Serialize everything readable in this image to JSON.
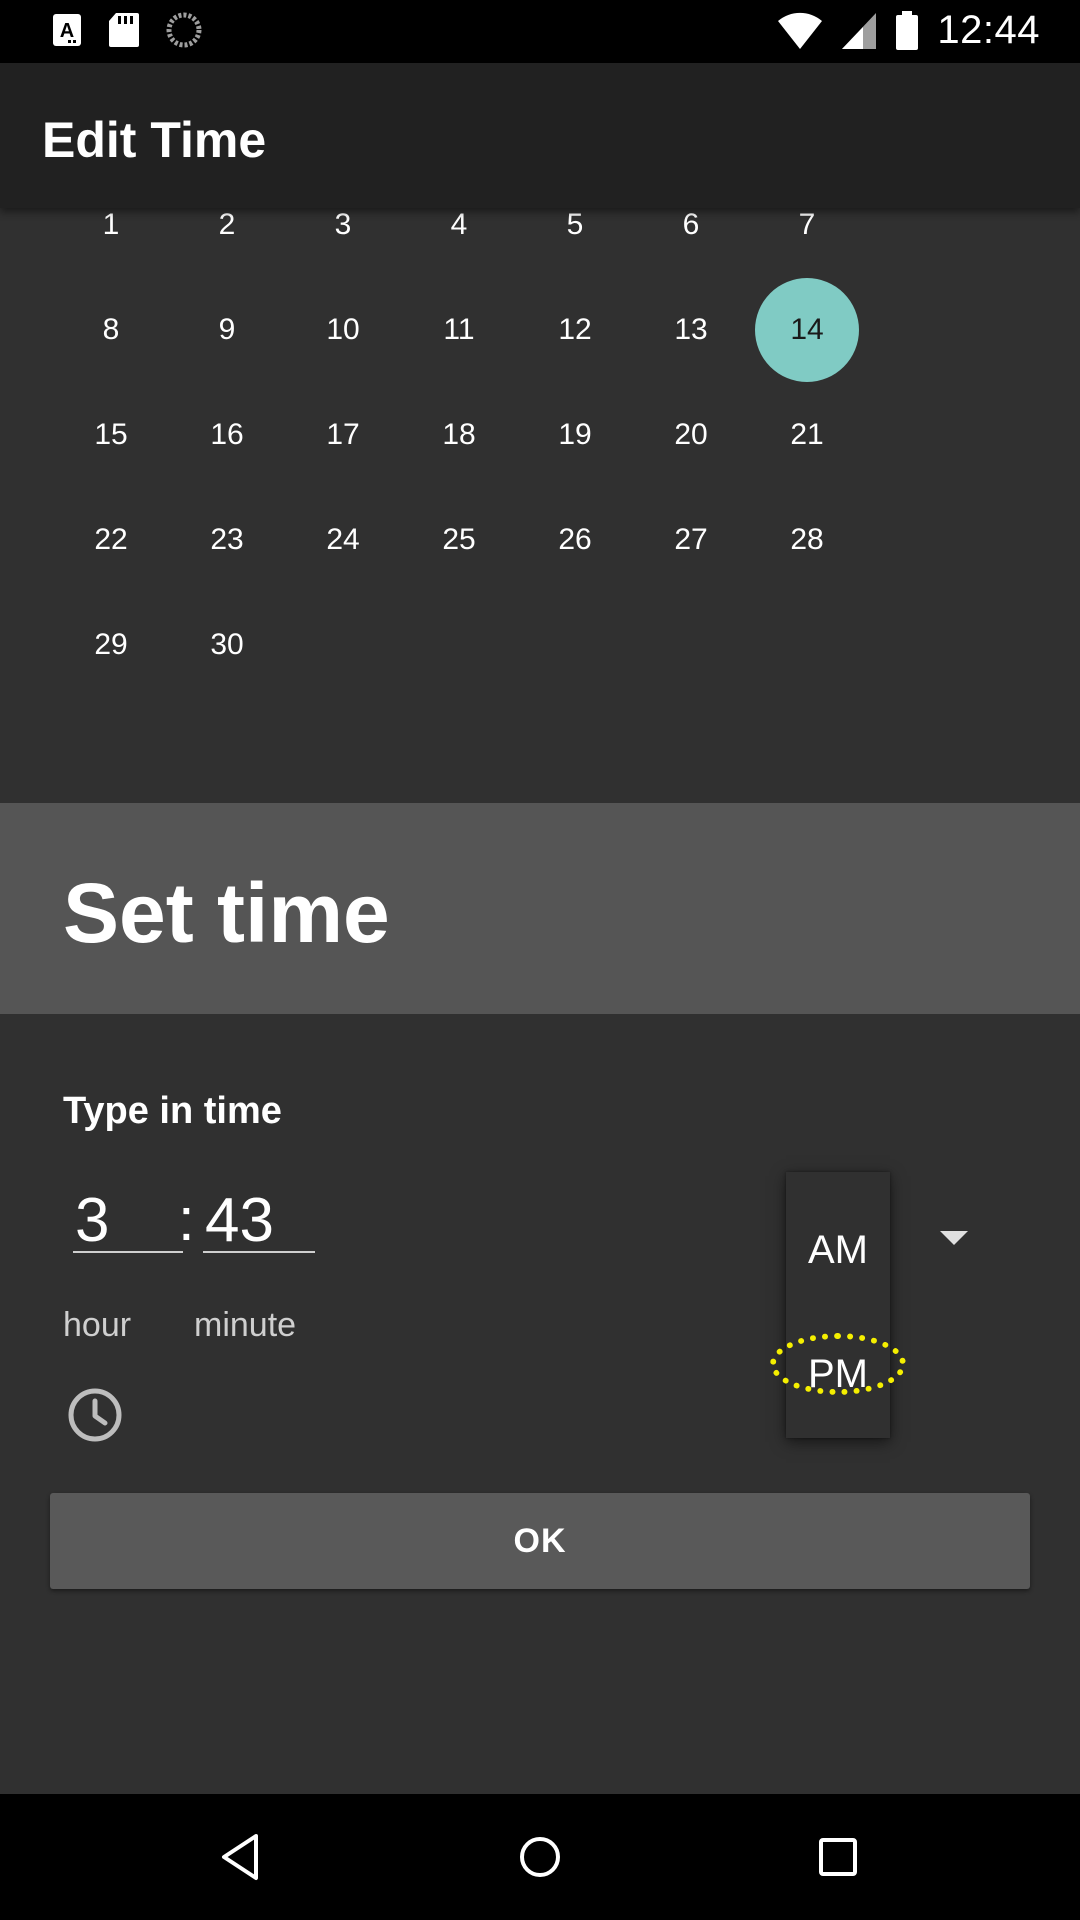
{
  "status_bar": {
    "time": "12:44",
    "left_icons": [
      "text-icon",
      "sd-card-icon",
      "sync-icon"
    ],
    "right_icons": [
      "wifi-icon",
      "signal-icon",
      "battery-icon"
    ]
  },
  "app_bar": {
    "title": "Edit Time"
  },
  "calendar": {
    "days": [
      "1",
      "2",
      "3",
      "4",
      "5",
      "6",
      "7",
      "8",
      "9",
      "10",
      "11",
      "12",
      "13",
      "14",
      "15",
      "16",
      "17",
      "18",
      "19",
      "20",
      "21",
      "22",
      "23",
      "24",
      "25",
      "26",
      "27",
      "28",
      "29",
      "30"
    ],
    "selected_day": "14",
    "selected_color": "#80cbc4"
  },
  "dialog": {
    "title": "Set time",
    "type_label": "Type in time",
    "hour_value": "3",
    "minute_value": "43",
    "separator": ":",
    "hour_hint": "hour",
    "minute_hint": "minute",
    "ampm_options": [
      "AM",
      "PM"
    ],
    "ok_label": "OK",
    "clock_icon": "clock-icon",
    "dropdown_icon": "dropdown-arrow-icon"
  },
  "nav_bar": {
    "icons": [
      "back-icon",
      "home-icon",
      "recents-icon"
    ]
  },
  "colors": {
    "background": "#303030",
    "app_bar": "#212121",
    "dialog_header": "#555555",
    "button": "#595959",
    "highlight_ring": "#f5ef00"
  }
}
